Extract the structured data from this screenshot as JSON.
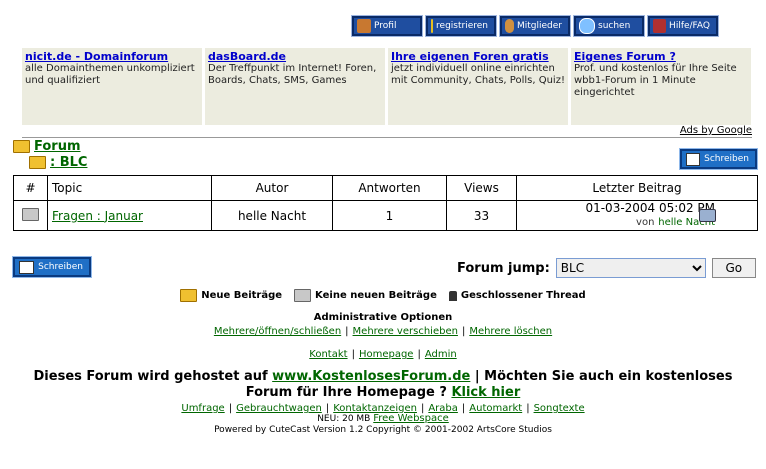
{
  "nav": {
    "buttons": [
      "Profil",
      "registrieren",
      "Mitglieder",
      "suchen",
      "Hilfe/FAQ"
    ]
  },
  "ads": [
    {
      "title": "nicit.de - Domainforum",
      "text": "alle Domainthemen unkompliziert und qualifiziert"
    },
    {
      "title": "dasBoard.de",
      "text": "Der Treffpunkt im Internet! Foren, Boards, Chats, SMS, Games"
    },
    {
      "title": "Ihre eigenen Foren gratis",
      "text": "jetzt individuell online einrichten mit Community, Chats, Polls, Quiz!"
    },
    {
      "title": "Eigenes Forum ?",
      "text": "Prof. und kostenlos für Ihre Seite wbb1-Forum in 1 Minute eingerichtet"
    }
  ],
  "ads_by": "Ads by Google",
  "breadcrumb": {
    "forum": "Forum",
    "sub": ": BLC"
  },
  "write_button": "Schreiben",
  "table": {
    "headers": [
      "#",
      "Topic",
      "Autor",
      "Antworten",
      "Views",
      "Letzter Beitrag"
    ],
    "rows": [
      {
        "topic": "Fragen : Januar",
        "author": "helle Nacht",
        "replies": "1",
        "views": "33",
        "last_date": "01-03-2004 05:02 PM",
        "last_by_prefix": "von",
        "last_by": "helle Nacht"
      }
    ]
  },
  "jump": {
    "label": "Forum jump:",
    "selected": "BLC",
    "go": "Go"
  },
  "legend": {
    "new": "Neue Beiträge",
    "nonew": "Keine neuen Beiträge",
    "closed": "Geschlossener Thread"
  },
  "admin": {
    "title": "Administrative Optionen",
    "links": [
      "Mehrere/öffnen/schließen",
      "Mehrere verschieben",
      "Mehrere löschen"
    ]
  },
  "footer_links": [
    "Kontakt",
    "Homepage",
    "Admin"
  ],
  "hosting": {
    "pre": "Dieses Forum wird gehostet auf",
    "site": "www.KostenlosesForum.de",
    "mid": "| Möchten Sie auch ein kostenloses",
    "line2": "Forum für Ihre Homepage ?",
    "click": "Klick hier"
  },
  "bottom_links": [
    "Umfrage",
    "Gebrauchtwagen",
    "Kontaktanzeigen",
    "Araba",
    "Automarkt",
    "Songtexte"
  ],
  "neu": {
    "prefix": "NEU: 20 MB",
    "link": "Free Webspace"
  },
  "powered": "Powered by CuteCast Version 1.2 Copyright © 2001-2002 ArtsCore Studios"
}
